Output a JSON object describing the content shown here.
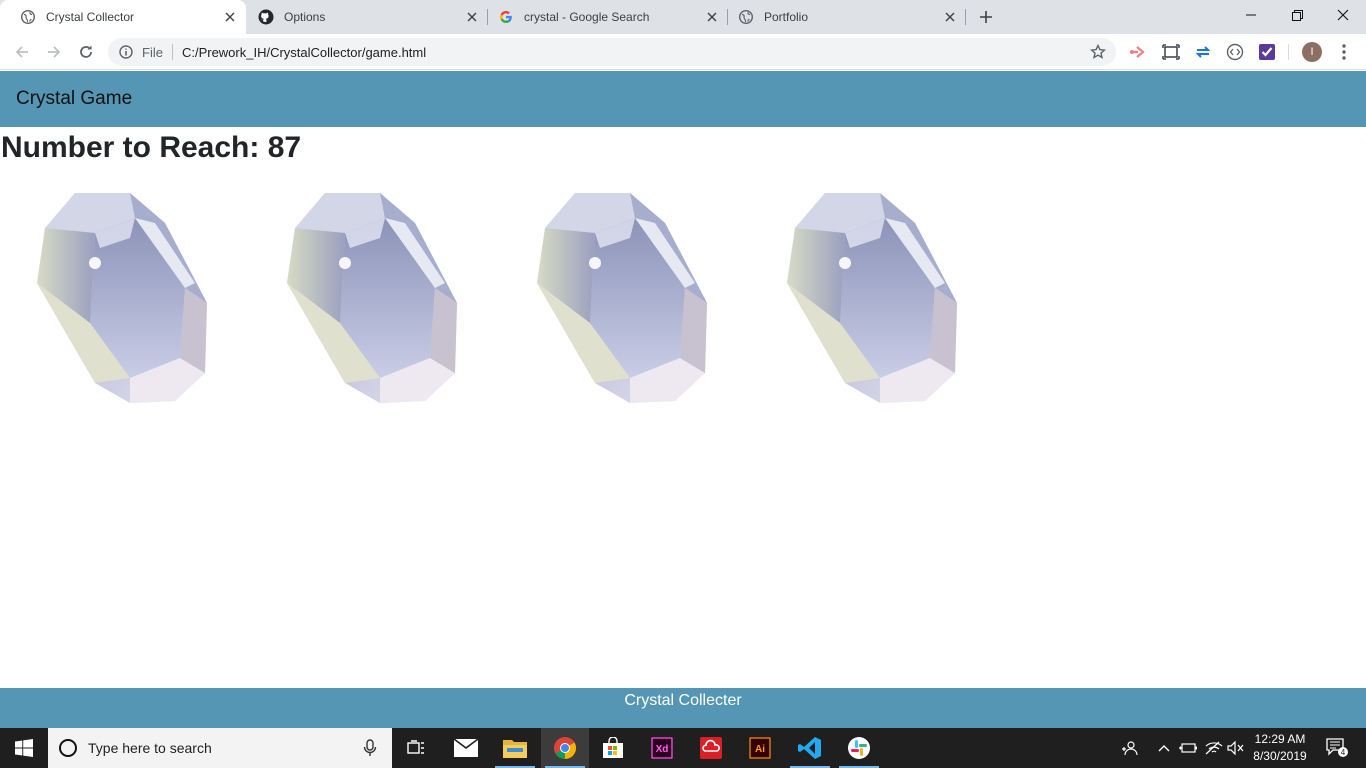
{
  "browser": {
    "tabs": [
      {
        "title": "Crystal Collector",
        "icon": "globe-icon",
        "active": true
      },
      {
        "title": "Options",
        "icon": "github-icon",
        "active": false
      },
      {
        "title": "crystal - Google Search",
        "icon": "google-icon",
        "active": false
      },
      {
        "title": "Portfolio",
        "icon": "globe-icon",
        "active": false
      }
    ],
    "address": {
      "scheme_label": "File",
      "url": "C:/Prework_IH/CrystalCollector/game.html"
    },
    "profile_initial": "I",
    "colors": {
      "tabstrip": "#dee1e6",
      "omnibox": "#f1f3f4"
    }
  },
  "page": {
    "brand": "Crystal Game",
    "target_label": "Number to Reach: 87",
    "crystals": [
      {
        "name": "crystal-1",
        "icon": "crystal-gem-image"
      },
      {
        "name": "crystal-2",
        "icon": "crystal-gem-image"
      },
      {
        "name": "crystal-3",
        "icon": "crystal-gem-image"
      },
      {
        "name": "crystal-4",
        "icon": "crystal-gem-image"
      }
    ],
    "footer_text": "Crystal Collecter",
    "colors": {
      "navbar": "#5596b5",
      "footer": "#5596b5"
    }
  },
  "taskbar": {
    "search_placeholder": "Type here to search",
    "apps": [
      "task-view",
      "mail",
      "file-explorer",
      "chrome",
      "store",
      "adobe-xd",
      "creative-cloud",
      "illustrator",
      "vscode",
      "slack"
    ],
    "clock": {
      "time": "12:29 AM",
      "date": "8/30/2019"
    },
    "notification_count": "4"
  }
}
